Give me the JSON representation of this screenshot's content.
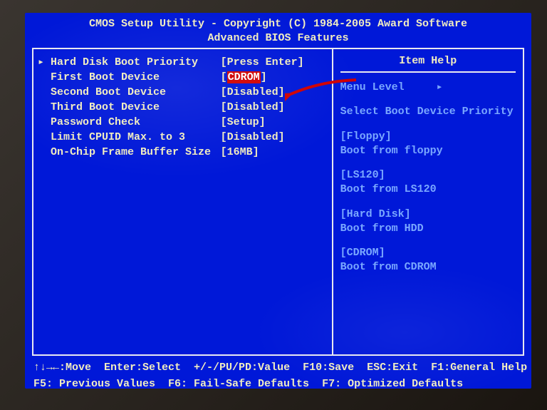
{
  "title": {
    "line1": "CMOS Setup Utility - Copyright (C) 1984-2005 Award Software",
    "line2": "Advanced BIOS Features"
  },
  "settings": [
    {
      "marker": "▸",
      "label": "Hard Disk Boot Priority",
      "value": "[Press Enter]",
      "highlighted": false
    },
    {
      "marker": "",
      "label": "First Boot Device",
      "value": "[CDROM]",
      "highlighted": true
    },
    {
      "marker": "",
      "label": "Second Boot Device",
      "value": "[Disabled]",
      "highlighted": false
    },
    {
      "marker": "",
      "label": "Third Boot Device",
      "value": "[Disabled]",
      "highlighted": false
    },
    {
      "marker": "",
      "label": "Password Check",
      "value": "[Setup]",
      "highlighted": false
    },
    {
      "marker": "",
      "label": "Limit CPUID Max. to 3",
      "value": "[Disabled]",
      "highlighted": false
    },
    {
      "marker": "",
      "label": "On-Chip Frame Buffer Size",
      "value": "[16MB]",
      "highlighted": false
    }
  ],
  "help": {
    "title": "Item Help",
    "menu_level_label": "Menu Level",
    "menu_level_arrow": "▸",
    "description": "Select Boot Device Priority",
    "options": [
      {
        "name": "[Floppy]",
        "desc": "Boot from floppy"
      },
      {
        "name": "[LS120]",
        "desc": "Boot from LS120"
      },
      {
        "name": "[Hard Disk]",
        "desc": "Boot from HDD"
      },
      {
        "name": "[CDROM]",
        "desc": "Boot from CDROM"
      }
    ]
  },
  "footer": {
    "row1": {
      "move": "↑↓→←:Move",
      "select": "Enter:Select",
      "value": "+/-/PU/PD:Value",
      "save": "F10:Save",
      "exit": "ESC:Exit",
      "general_help": "F1:General Help"
    },
    "row2": {
      "previous": "F5: Previous Values",
      "failsafe": "F6: Fail-Safe Defaults",
      "optimized": "F7: Optimized Defaults"
    }
  },
  "arrow_color": "#d00000"
}
